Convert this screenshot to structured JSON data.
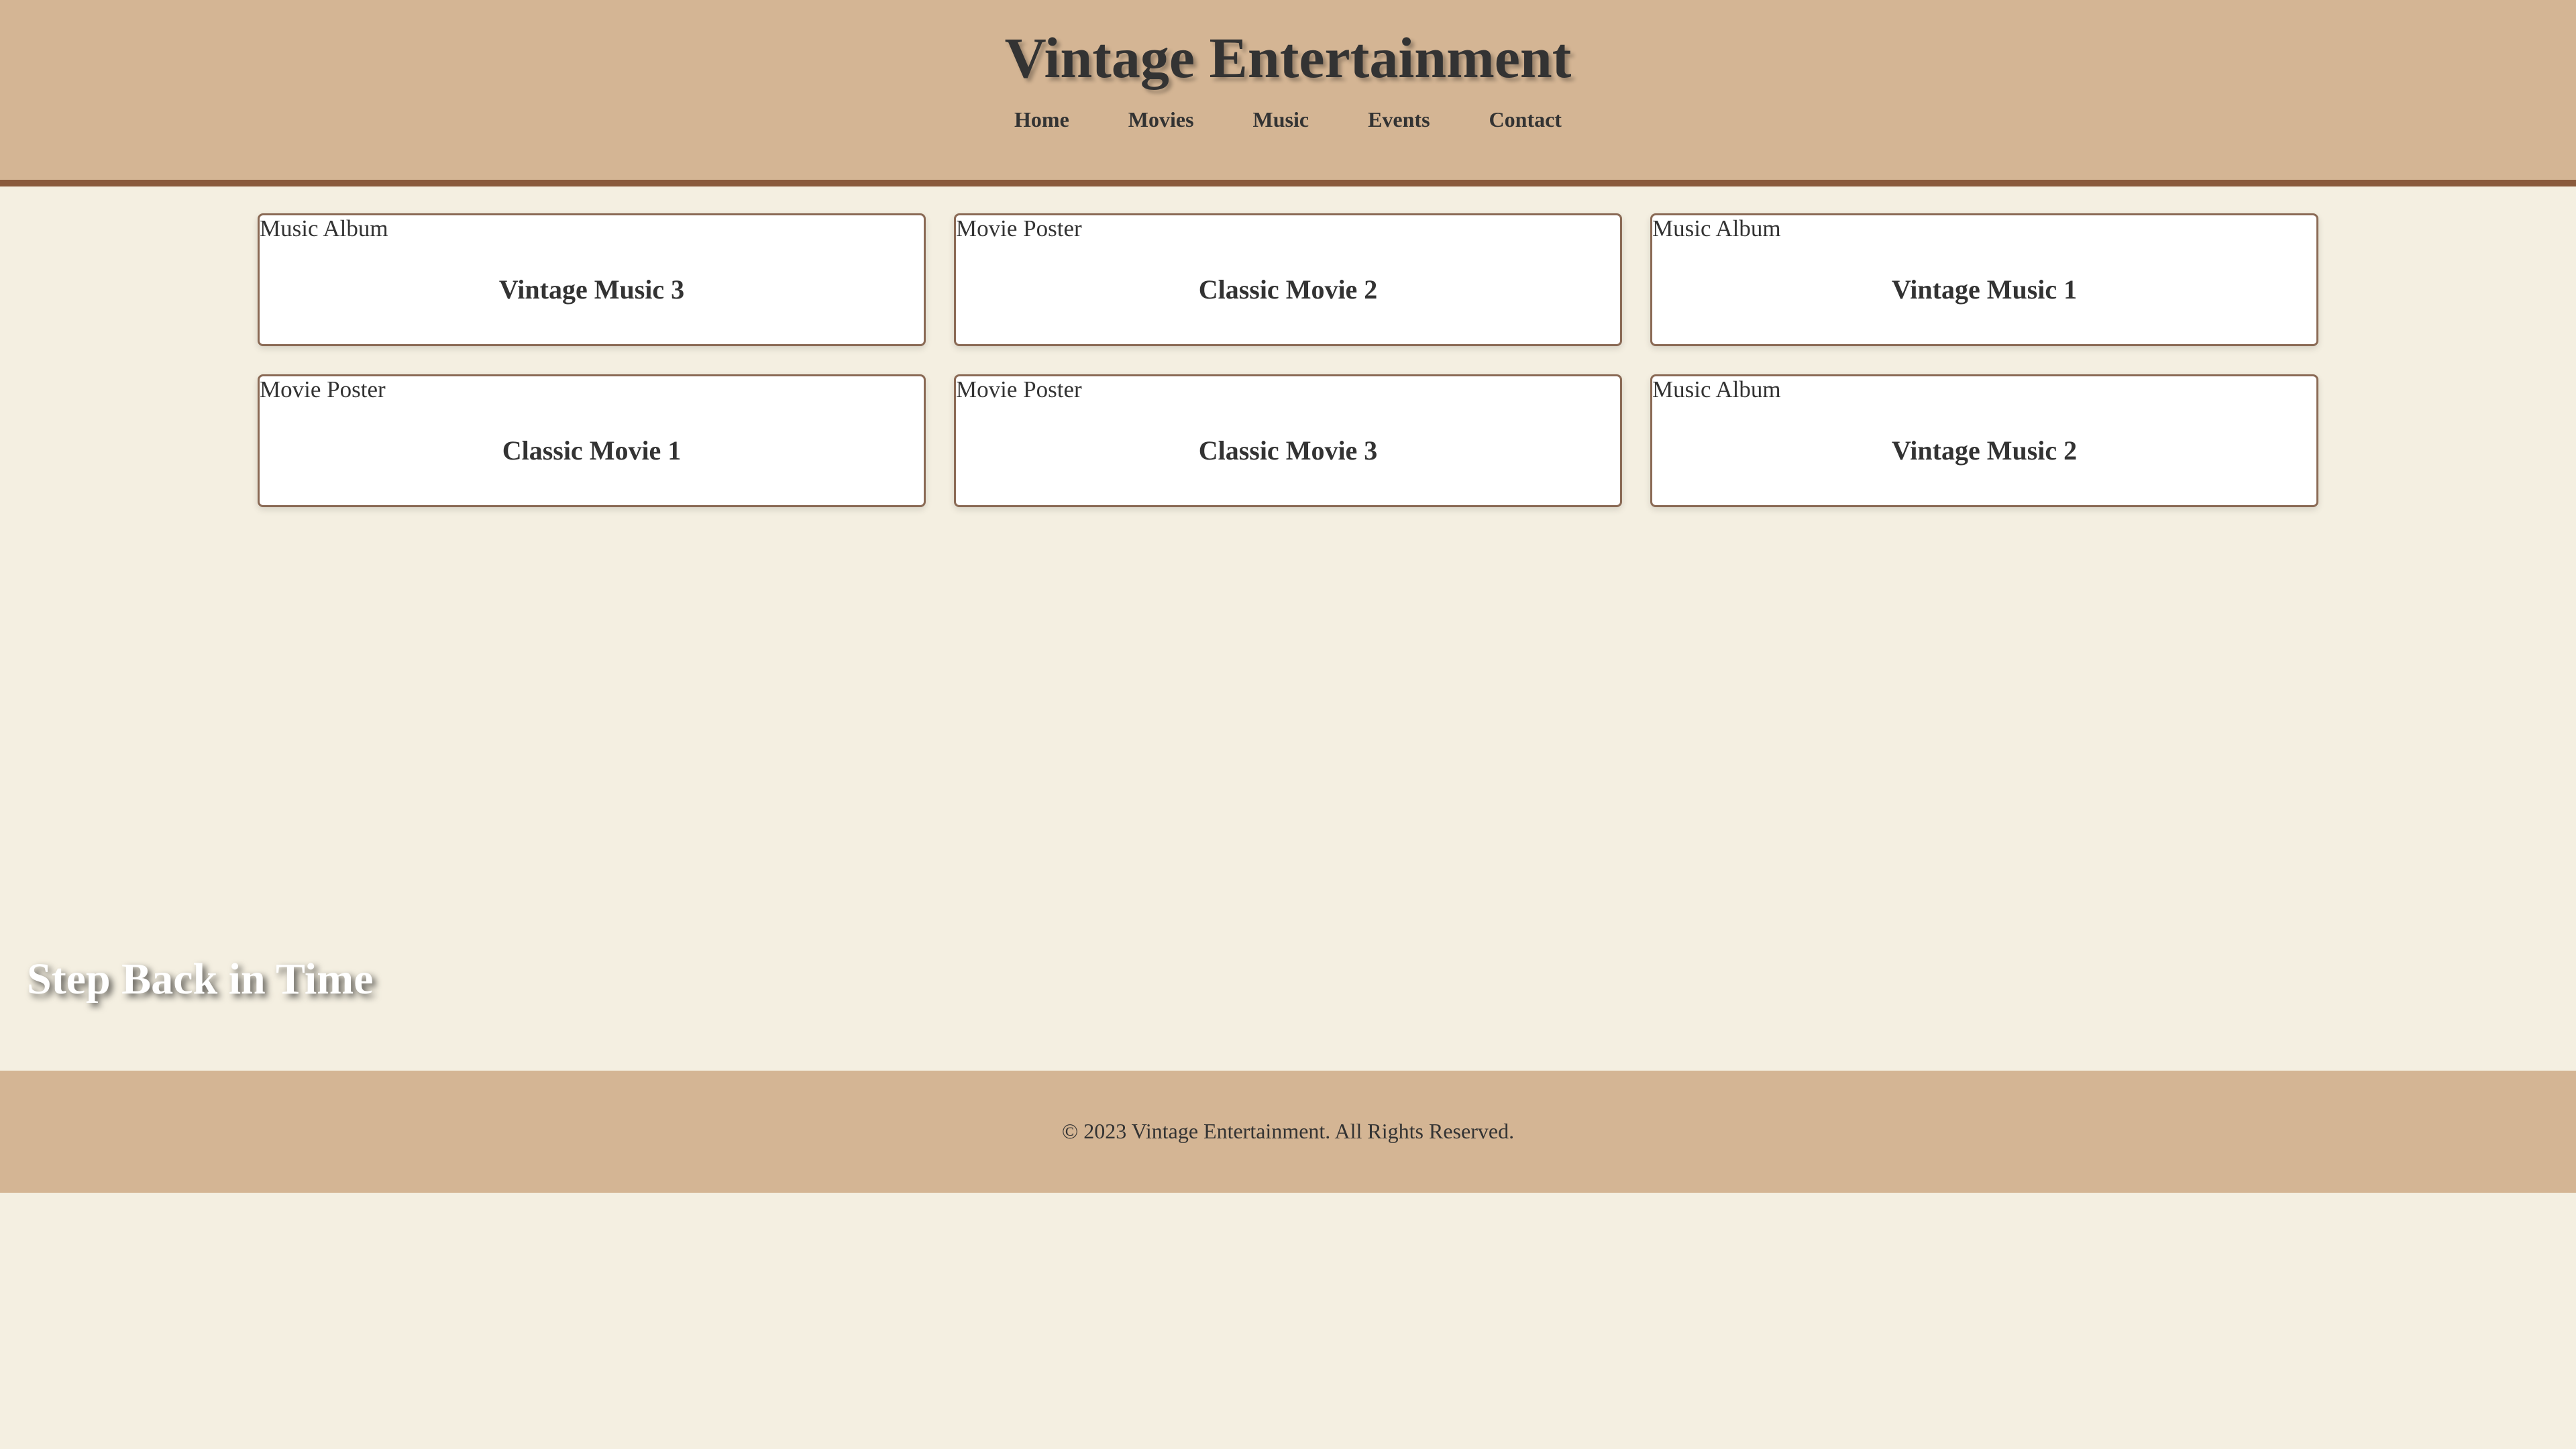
{
  "header": {
    "title": "Vintage Entertainment",
    "nav": [
      {
        "label": "Home"
      },
      {
        "label": "Movies"
      },
      {
        "label": "Music"
      },
      {
        "label": "Events"
      },
      {
        "label": "Contact"
      }
    ]
  },
  "cards": [
    {
      "alt": "Music Album",
      "title": "Vintage Music 3"
    },
    {
      "alt": "Movie Poster",
      "title": "Classic Movie 2"
    },
    {
      "alt": "Music Album",
      "title": "Vintage Music 1"
    },
    {
      "alt": "Movie Poster",
      "title": "Classic Movie 1"
    },
    {
      "alt": "Movie Poster",
      "title": "Classic Movie 3"
    },
    {
      "alt": "Music Album",
      "title": "Vintage Music 2"
    }
  ],
  "hero": {
    "tagline": "Step Back in Time"
  },
  "footer": {
    "copyright": "© 2023 Vintage Entertainment. All Rights Reserved."
  },
  "colors": {
    "header_bg": "#d4b594",
    "header_border": "#8a5a3c",
    "page_bg": "#f4efe1",
    "text": "#333333"
  }
}
